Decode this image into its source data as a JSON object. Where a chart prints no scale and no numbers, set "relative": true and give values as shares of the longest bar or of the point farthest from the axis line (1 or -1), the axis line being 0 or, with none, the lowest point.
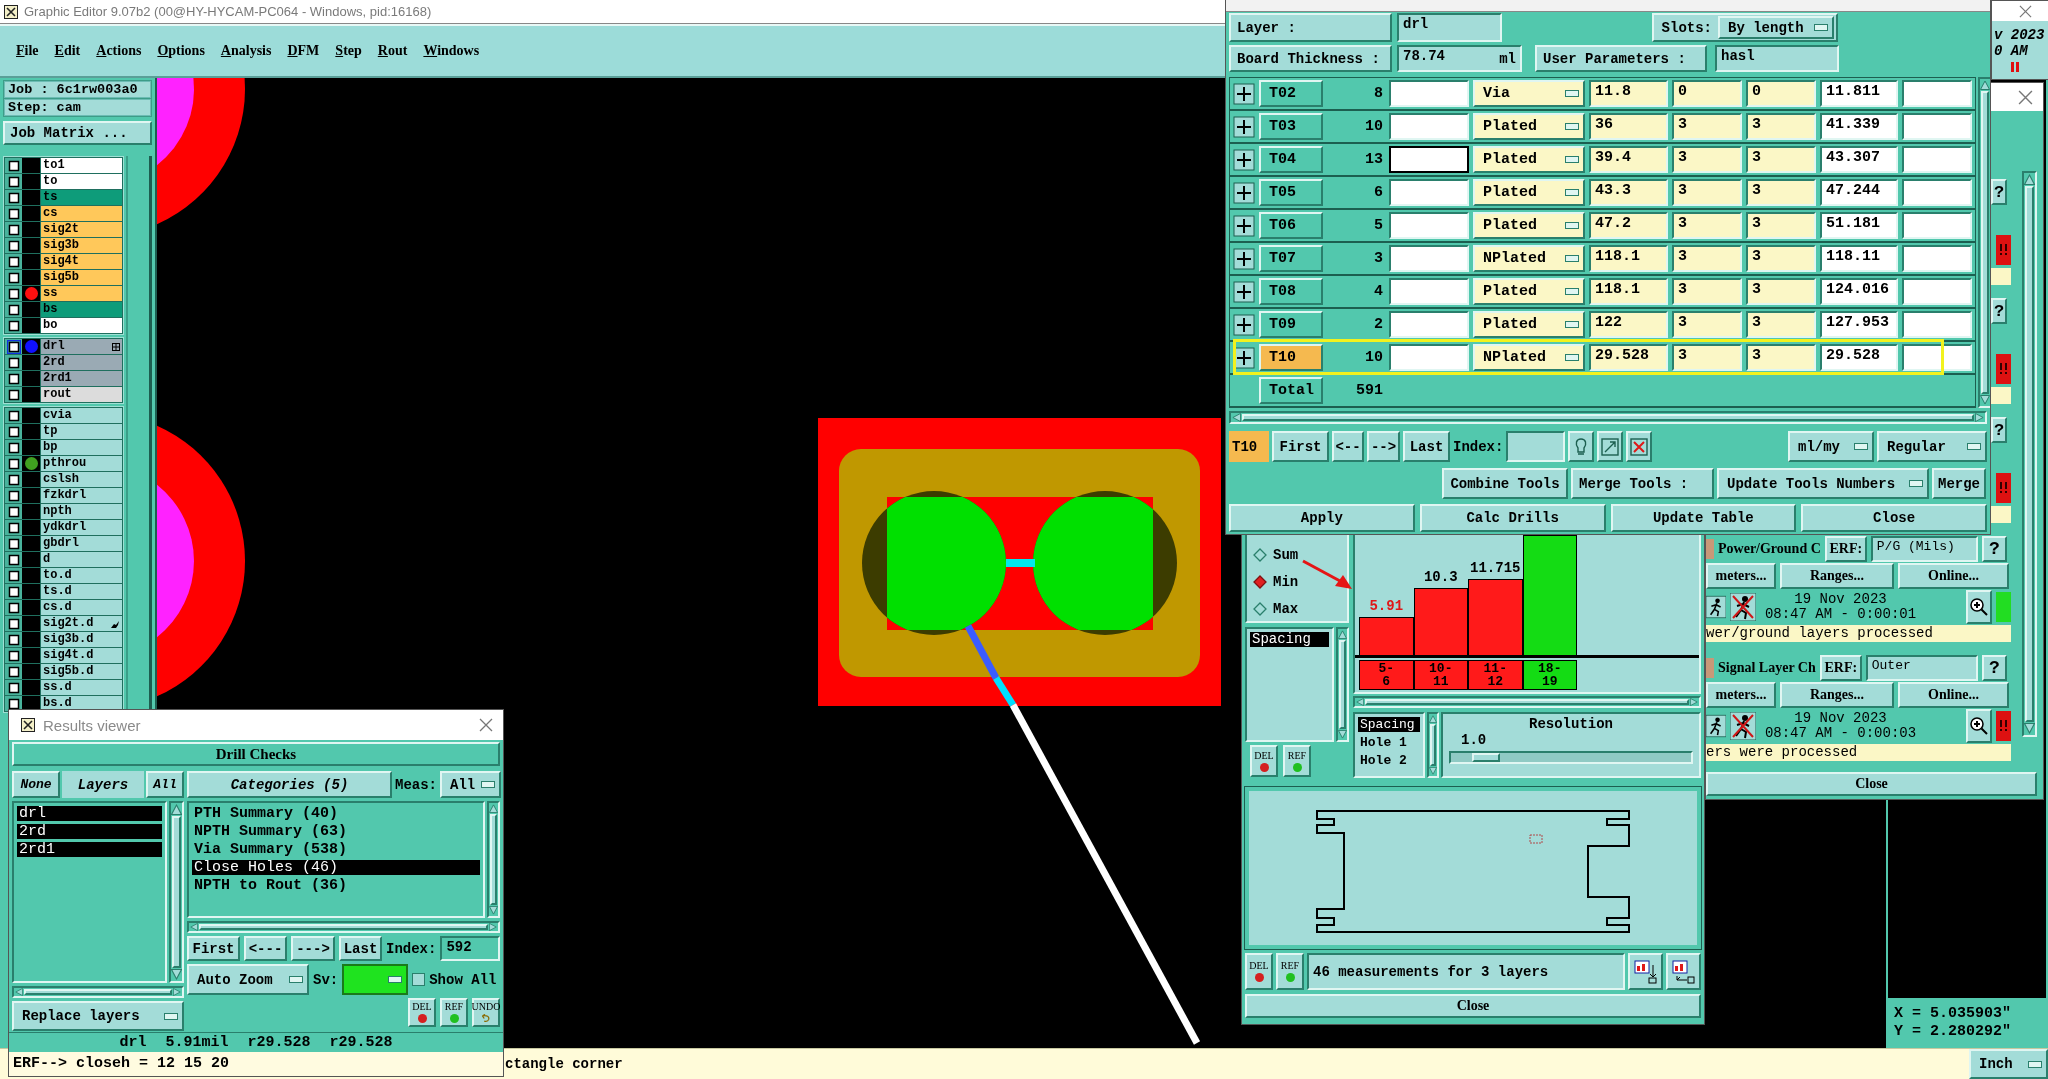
{
  "main_window": {
    "title": "Graphic Editor 9.07b2 (00@HY-HYCAM-PC064 - Windows, pid:16168)",
    "menu": [
      "File",
      "Edit",
      "Actions",
      "Options",
      "Analysis",
      "DFM",
      "Step",
      "Rout",
      "Windows"
    ],
    "job": "Job : 6c1rw003a0",
    "step": "Step: cam",
    "matrix_button": "Job Matrix ...",
    "status": "ctangle corner",
    "coordinates": [
      "X = 5.035903\"",
      "Y = 2.280292\""
    ],
    "units": "Inch"
  },
  "layers": [
    [
      {
        "name": "to1",
        "color": "#ffffff",
        "selected": false
      },
      {
        "name": "to",
        "color": "#ffffff",
        "selected": false
      },
      {
        "name": "ts",
        "color": "#0e9c7a",
        "selected": false
      },
      {
        "name": "cs",
        "color": "#ffc85a",
        "selected": false
      },
      {
        "name": "sig2t",
        "color": "#ffc85a",
        "selected": false
      },
      {
        "name": "sig3b",
        "color": "#ffc85a",
        "selected": false
      },
      {
        "name": "sig4t",
        "color": "#ffc85a",
        "selected": false
      },
      {
        "name": "sig5b",
        "color": "#ffc85a",
        "selected": false
      },
      {
        "name": "ss",
        "color": "#ffc85a",
        "dot": {
          "color": "#ff1010"
        },
        "selected": false
      },
      {
        "name": "bs",
        "color": "#0e9c7a",
        "selected": false
      },
      {
        "name": "bo",
        "color": "#ffffff",
        "selected": false
      }
    ],
    [
      {
        "name": "drl",
        "color": "#9aaab4",
        "dot": {
          "color": "#1010ff"
        },
        "badge": {
          "kind": "grid"
        },
        "selected": true
      },
      {
        "name": "2rd",
        "color": "#9aaab4",
        "selected": false
      },
      {
        "name": "2rd1",
        "color": "#9aaab4",
        "selected": false
      },
      {
        "name": "rout",
        "color": "#dcdcdc",
        "selected": false
      }
    ],
    [
      {
        "name": "cvia",
        "color": "#a3dcd8",
        "selected": false
      },
      {
        "name": "tp",
        "color": "#a3dcd8",
        "selected": false
      },
      {
        "name": "bp",
        "color": "#a3dcd8",
        "selected": false
      },
      {
        "name": "pthrou",
        "color": "#a3dcd8",
        "dot": {
          "color": "#40a020"
        },
        "selected": false
      },
      {
        "name": "cslsh",
        "color": "#a3dcd8",
        "selected": false
      },
      {
        "name": "fzkdrl",
        "color": "#a3dcd8",
        "selected": false
      },
      {
        "name": "npth",
        "color": "#a3dcd8",
        "selected": false
      },
      {
        "name": "ydkdrl",
        "color": "#a3dcd8",
        "selected": false
      },
      {
        "name": "gbdrl",
        "color": "#a3dcd8",
        "selected": false
      },
      {
        "name": "d",
        "color": "#a3dcd8",
        "selected": false
      },
      {
        "name": "to.d",
        "color": "#a3dcd8",
        "selected": false
      },
      {
        "name": "ts.d",
        "color": "#a3dcd8",
        "selected": false
      },
      {
        "name": "cs.d",
        "color": "#a3dcd8",
        "selected": false
      },
      {
        "name": "sig2t.d",
        "color": "#a3dcd8",
        "badge": {
          "kind": "hand"
        },
        "selected": false
      },
      {
        "name": "sig3b.d",
        "color": "#a3dcd8",
        "selected": false
      },
      {
        "name": "sig4t.d",
        "color": "#a3dcd8",
        "selected": false
      },
      {
        "name": "sig5b.d",
        "color": "#a3dcd8",
        "selected": false
      },
      {
        "name": "ss.d",
        "color": "#a3dcd8",
        "selected": false
      },
      {
        "name": "bs.d",
        "color": "#a3dcd8",
        "selected": false
      }
    ]
  ],
  "results_viewer": {
    "title": "Results viewer",
    "header": "Drill Checks",
    "layer_buttons": [
      {
        "label": "None",
        "kind": "button"
      },
      {
        "label": "Layers",
        "kind": "label"
      },
      {
        "label": "All",
        "kind": "button"
      }
    ],
    "layers": [
      {
        "name": "drl",
        "selected": true
      },
      {
        "name": "2rd",
        "selected": true
      },
      {
        "name": "2rd1",
        "selected": true
      }
    ],
    "categories_title": "Categories (5)",
    "meas_label": "Meas:",
    "meas_value": "All",
    "categories": [
      {
        "label": "PTH Summary (40)",
        "selected": false
      },
      {
        "label": "NPTH Summary (63)",
        "selected": false
      },
      {
        "label": "Via Summary (538)",
        "selected": false
      },
      {
        "label": "Close Holes (46)",
        "selected": true
      },
      {
        "label": "NPTH to Rout (36)",
        "selected": false
      }
    ],
    "nav": [
      "First",
      "<---",
      "--->",
      "Last"
    ],
    "index_label": "Index:",
    "index": "592",
    "zoom_mode": "Auto Zoom",
    "sv_label": "Sv:",
    "sv": {
      "color": "#1fe31f"
    },
    "show_all": {
      "label": "Show All",
      "checked": false
    },
    "replace_mode": "Replace layers",
    "actions": [
      {
        "label": "DEL",
        "kind": "dot",
        "color": "#d42020"
      },
      {
        "label": "REF",
        "kind": "dot",
        "color": "#20c020"
      },
      {
        "label": "UNDO",
        "kind": "undo"
      }
    ],
    "measurement": "drl 5.91mil r29.528 r29.528",
    "erf": "ERF--> closeh = 12 15 20"
  },
  "tool_manager": {
    "layer_label": "Layer :",
    "layer": "drl",
    "slots_label": "Slots:",
    "slots": "By length",
    "thickness_label": "Board Thickness :",
    "thickness": "78.74",
    "thickness_unit": "ml",
    "user_params_label": "User Parameters :",
    "user_params": "hasl",
    "tools": [
      {
        "name": "T02",
        "count": "8",
        "type": "Via",
        "finish": "11.8",
        "plus_tol": "0",
        "minus_tol": "0",
        "drill": "11.811",
        "selected": false,
        "focused": false,
        "outlined": false
      },
      {
        "name": "T03",
        "count": "10",
        "type": "Plated",
        "finish": "36",
        "plus_tol": "3",
        "minus_tol": "3",
        "drill": "41.339",
        "selected": false,
        "focused": false,
        "outlined": false
      },
      {
        "name": "T04",
        "count": "13",
        "type": "Plated",
        "finish": "39.4",
        "plus_tol": "3",
        "minus_tol": "3",
        "drill": "43.307",
        "selected": false,
        "focused": true,
        "outlined": false
      },
      {
        "name": "T05",
        "count": "6",
        "type": "Plated",
        "finish": "43.3",
        "plus_tol": "3",
        "minus_tol": "3",
        "drill": "47.244",
        "selected": false,
        "focused": false,
        "outlined": false
      },
      {
        "name": "T06",
        "count": "5",
        "type": "Plated",
        "finish": "47.2",
        "plus_tol": "3",
        "minus_tol": "3",
        "drill": "51.181",
        "selected": false,
        "focused": false,
        "outlined": false
      },
      {
        "name": "T07",
        "count": "3",
        "type": "NPlated",
        "finish": "118.1",
        "plus_tol": "3",
        "minus_tol": "3",
        "drill": "118.11",
        "selected": false,
        "focused": false,
        "outlined": false
      },
      {
        "name": "T08",
        "count": "4",
        "type": "Plated",
        "finish": "118.1",
        "plus_tol": "3",
        "minus_tol": "3",
        "drill": "124.016",
        "selected": false,
        "focused": false,
        "outlined": false
      },
      {
        "name": "T09",
        "count": "2",
        "type": "Plated",
        "finish": "122",
        "plus_tol": "3",
        "minus_tol": "3",
        "drill": "127.953",
        "selected": false,
        "focused": false,
        "outlined": false
      },
      {
        "name": "T10",
        "count": "10",
        "type": "NPlated",
        "finish": "29.528",
        "plus_tol": "3",
        "minus_tol": "3",
        "drill": "29.528",
        "selected": true,
        "focused": false,
        "outlined": true
      }
    ],
    "total_label": "Total",
    "total": "591",
    "current_tool": "T10",
    "nav": [
      "First",
      "<--",
      "-->",
      "Last"
    ],
    "index_label": "Index:",
    "units": "ml/my",
    "mode": "Regular",
    "combine": "Combine Tools",
    "merge_label": "Merge Tools :",
    "merge_mode": "Update Tools Numbers",
    "merge": "Merge",
    "buttons": [
      "Apply",
      "Calc Drills",
      "Update Table",
      "Close"
    ]
  },
  "histogram": {
    "modes": [
      {
        "label": "Sum",
        "selected": false
      },
      {
        "label": "Min",
        "selected": true
      },
      {
        "label": "Max",
        "selected": false
      }
    ],
    "measures": [
      {
        "label": "Spacing",
        "selected": true
      }
    ],
    "list_actions": [
      {
        "label": "DEL",
        "kind": "dot",
        "color": "#d42020"
      },
      {
        "label": "REF",
        "kind": "dot",
        "color": "#20c020"
      }
    ],
    "chart_data": {
      "type": "bar",
      "categories": [
        "5-6",
        "10-11",
        "11-12",
        "18-19"
      ],
      "series": [
        {
          "values": [
            0.32,
            0.557,
            0.633,
            1
          ]
        }
      ],
      "relative": true,
      "value_labels": [
        "5.91",
        "10.3",
        "11.715",
        null
      ]
    },
    "bars": [
      {
        "color": "#ff1a1a"
      },
      {
        "color": "#ff1a1a"
      },
      {
        "color": "#ff1a1a"
      },
      {
        "color": "#14dc14"
      }
    ],
    "details": [
      {
        "label": "Spacing",
        "selected": true
      },
      {
        "label": "Hole 1",
        "selected": false
      },
      {
        "label": "Hole 2",
        "selected": false
      }
    ],
    "resolution_label": "Resolution",
    "resolution": "1.0",
    "resolution_slider": {
      "level": 0.1
    },
    "actions": [
      {
        "label": "DEL",
        "kind": "dot",
        "color": "#d42020"
      },
      {
        "label": "REF",
        "kind": "dot",
        "color": "#20c020"
      }
    ],
    "summary": "46 measurements for 3 layers",
    "close": "Close"
  },
  "checklist": {
    "items": [
      {
        "kind": "covered",
        "help": "?",
        "failed": true
      },
      {
        "kind": "covered",
        "help": "?",
        "failed": true
      },
      {
        "kind": "covered",
        "help": "?",
        "failed": true
      },
      {
        "kind": "full",
        "name": "Power/Ground C",
        "erf_label": "ERF:",
        "erf": "P/G (Mils)",
        "help": "?",
        "buttons": [
          "meters...",
          "Ranges...",
          "Online..."
        ],
        "date": "19 Nov 2023",
        "time": "08:47 AM - 0:00:01",
        "failed": false,
        "message": "wer/ground layers processed"
      },
      {
        "kind": "full",
        "name": "Signal Layer Ch",
        "erf_label": "ERF:",
        "erf": "Outer",
        "help": "?",
        "buttons": [
          "meters...",
          "Ranges...",
          "Online..."
        ],
        "date": "19 Nov 2023",
        "time": "08:47 AM - 0:00:03",
        "failed": true,
        "message": "ers were processed"
      }
    ],
    "close": "Close"
  },
  "back_window": {
    "date": "v 2023",
    "time": "0 AM"
  }
}
